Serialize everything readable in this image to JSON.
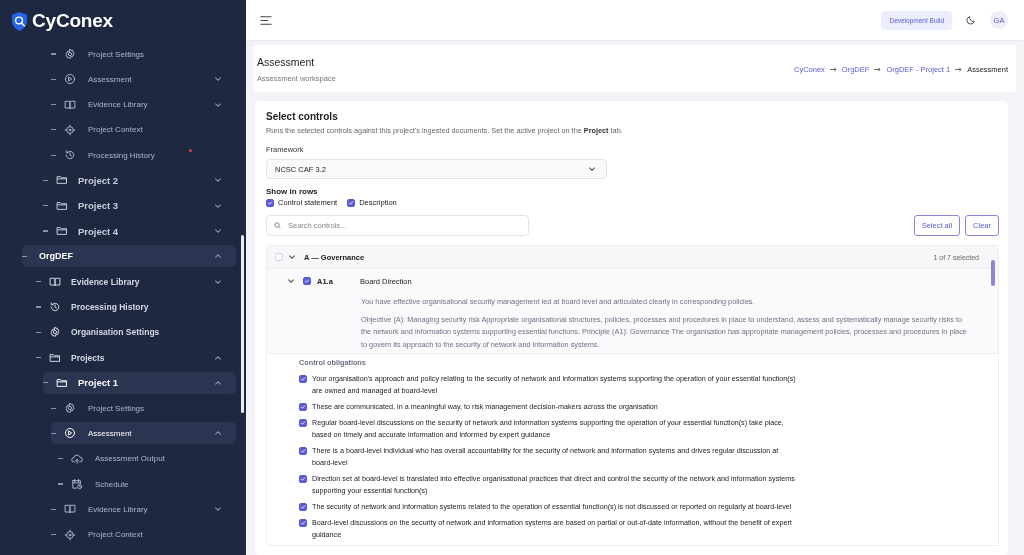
{
  "brand": {
    "name": "CyConex"
  },
  "sidebar": {
    "scrolled_items": [
      {
        "label": "Project Settings",
        "kind": "settings",
        "selected": false,
        "alert": false
      },
      {
        "label": "Assessment",
        "kind": "assessment",
        "selected": false,
        "alert": false,
        "expanded": false
      },
      {
        "label": "Evidence Library",
        "kind": "library",
        "selected": false,
        "alert": false,
        "expanded": false
      },
      {
        "label": "Project Context",
        "kind": "context",
        "selected": false,
        "alert": false
      },
      {
        "label": "Processing History",
        "kind": "history",
        "selected": false,
        "alert": true
      }
    ],
    "projects": [
      {
        "label": "Project 2",
        "kind": "project",
        "selected": false,
        "expanded": false
      },
      {
        "label": "Project 3",
        "kind": "project",
        "selected": false,
        "expanded": false
      },
      {
        "label": "Project 4",
        "kind": "project",
        "selected": false,
        "expanded": false
      }
    ],
    "items": [
      {
        "label": "OrgDEF",
        "selected": true,
        "expanded": true,
        "children": [
          {
            "label": "Evidence Library",
            "kind": "library",
            "selected": false,
            "expanded": false
          },
          {
            "label": "Processing History",
            "kind": "history",
            "selected": false
          },
          {
            "label": "Organisation Settings",
            "kind": "settings",
            "selected": false
          },
          {
            "label": "Projects",
            "kind": "project",
            "selected": false,
            "expanded": true,
            "children": [
              {
                "label": "Project 1",
                "kind": "project",
                "selected": true,
                "expanded": true,
                "children": [
                  {
                    "label": "Project Settings",
                    "kind": "settings",
                    "selected": false
                  },
                  {
                    "label": "Assessment",
                    "kind": "assessment",
                    "selected": true,
                    "expanded": true,
                    "children": [
                      {
                        "label": "Assessment Output",
                        "kind": "output",
                        "selected": false
                      },
                      {
                        "label": "Schedule",
                        "kind": "schedule",
                        "selected": false
                      }
                    ]
                  },
                  {
                    "label": "Evidence Library",
                    "kind": "library",
                    "selected": false,
                    "expanded": false
                  },
                  {
                    "label": "Project Context",
                    "kind": "context",
                    "selected": false
                  }
                ]
              }
            ]
          }
        ]
      }
    ]
  },
  "topbar": {
    "badge": "Development Build",
    "avatar": "GA"
  },
  "header": {
    "title": "Assessment",
    "subtitle": "Assessment workspace",
    "breadcrumb": [
      "CyConex",
      "OrgDEF",
      "OrgDEF - Project 1",
      "Assessment"
    ]
  },
  "controls": {
    "title": "Select controls",
    "description": "Runs the selected controls against this project's ingested documents. Set the active project on the **Project** tab.",
    "framework": {
      "label": "Framework",
      "value": "NCSC CAF 3.2"
    },
    "show_in_rows": {
      "label": "Show in rows",
      "options": [
        {
          "label": "Control statement",
          "checked": true
        },
        {
          "label": "Description",
          "checked": true
        }
      ]
    },
    "search": {
      "placeholder": "Search controls..."
    },
    "buttons": [
      "Select all",
      "Clear"
    ],
    "groups": [
      {
        "title": "A — Governance",
        "checked": false,
        "expanded": true,
        "count": "1 of 7 selected",
        "items": [
          {
            "code": "A1.a",
            "name": "Board Direction",
            "checked": true,
            "expanded": true,
            "statement": "You have effective organisational security management led at board level and articulated clearly in corresponding policies.",
            "description": "Objective (A): Managing security risk Appropriate organisational structures, policies, processes and procedures in place to understand, assess and systematically manage security risks to the network and information systems supporting essential functions. Principle (A1): Governance The organisation has appropriate management policies, processes and procedures in place to govern its approach to the security of network and information systems.",
            "obligations_title": "Control obligations",
            "obligations": [
              {
                "text": "Your organisation's approach and policy relating to the security of network and information systems supporting the operation of your essential function(s) are owned and managed at board-level",
                "checked": true
              },
              {
                "text": "These are communicated, in a meaningful way, to risk management decision-makers across the organisation",
                "checked": true
              },
              {
                "text": "Regular board-level discussions on the security of network and information systems supporting the operation of your essential function(s) take place, based on timely and accurate information and informed by expert guidance",
                "checked": true
              },
              {
                "text": "There is a board-level individual who has overall accountability for the security of network and information systems and drives regular discussion at board-level",
                "checked": true
              },
              {
                "text": "Direction set at board-level is translated into effective organisational practices that direct and control the security of the network and information systems supporting your essential function(s)",
                "checked": true
              },
              {
                "text": "The security of network and information systems related to the operation of essential function(s) is not discussed or reported on regularly at board-level",
                "checked": true
              },
              {
                "text": "Board-level discussions on the security of network and information systems are based on partial or out-of-date information, without the benefit of expert guidance",
                "checked": true
              }
            ]
          }
        ]
      }
    ]
  }
}
